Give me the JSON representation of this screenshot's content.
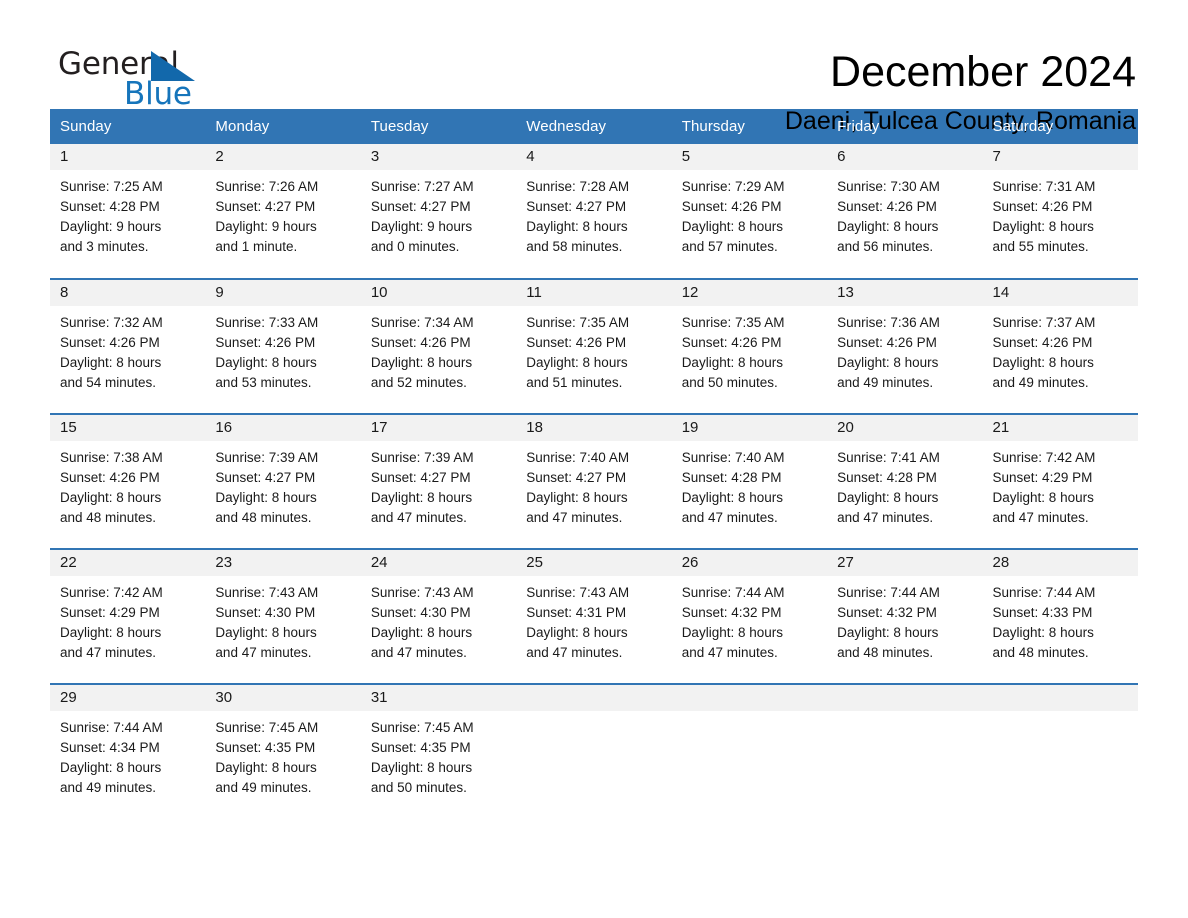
{
  "brand": {
    "name_part1": "General",
    "name_part2": "Blue",
    "accent_color": "#1268ab"
  },
  "header": {
    "month_title": "December 2024",
    "location": "Daeni, Tulcea County, Romania"
  },
  "calendar": {
    "header_background": "#3175b4",
    "daynum_background": "#f2f2f2",
    "weekday_headers": [
      "Sunday",
      "Monday",
      "Tuesday",
      "Wednesday",
      "Thursday",
      "Friday",
      "Saturday"
    ],
    "weeks": [
      [
        {
          "day": "1",
          "sunrise": "Sunrise: 7:25 AM",
          "sunset": "Sunset: 4:28 PM",
          "daylight_line1": "Daylight: 9 hours",
          "daylight_line2": "and 3 minutes."
        },
        {
          "day": "2",
          "sunrise": "Sunrise: 7:26 AM",
          "sunset": "Sunset: 4:27 PM",
          "daylight_line1": "Daylight: 9 hours",
          "daylight_line2": "and 1 minute."
        },
        {
          "day": "3",
          "sunrise": "Sunrise: 7:27 AM",
          "sunset": "Sunset: 4:27 PM",
          "daylight_line1": "Daylight: 9 hours",
          "daylight_line2": "and 0 minutes."
        },
        {
          "day": "4",
          "sunrise": "Sunrise: 7:28 AM",
          "sunset": "Sunset: 4:27 PM",
          "daylight_line1": "Daylight: 8 hours",
          "daylight_line2": "and 58 minutes."
        },
        {
          "day": "5",
          "sunrise": "Sunrise: 7:29 AM",
          "sunset": "Sunset: 4:26 PM",
          "daylight_line1": "Daylight: 8 hours",
          "daylight_line2": "and 57 minutes."
        },
        {
          "day": "6",
          "sunrise": "Sunrise: 7:30 AM",
          "sunset": "Sunset: 4:26 PM",
          "daylight_line1": "Daylight: 8 hours",
          "daylight_line2": "and 56 minutes."
        },
        {
          "day": "7",
          "sunrise": "Sunrise: 7:31 AM",
          "sunset": "Sunset: 4:26 PM",
          "daylight_line1": "Daylight: 8 hours",
          "daylight_line2": "and 55 minutes."
        }
      ],
      [
        {
          "day": "8",
          "sunrise": "Sunrise: 7:32 AM",
          "sunset": "Sunset: 4:26 PM",
          "daylight_line1": "Daylight: 8 hours",
          "daylight_line2": "and 54 minutes."
        },
        {
          "day": "9",
          "sunrise": "Sunrise: 7:33 AM",
          "sunset": "Sunset: 4:26 PM",
          "daylight_line1": "Daylight: 8 hours",
          "daylight_line2": "and 53 minutes."
        },
        {
          "day": "10",
          "sunrise": "Sunrise: 7:34 AM",
          "sunset": "Sunset: 4:26 PM",
          "daylight_line1": "Daylight: 8 hours",
          "daylight_line2": "and 52 minutes."
        },
        {
          "day": "11",
          "sunrise": "Sunrise: 7:35 AM",
          "sunset": "Sunset: 4:26 PM",
          "daylight_line1": "Daylight: 8 hours",
          "daylight_line2": "and 51 minutes."
        },
        {
          "day": "12",
          "sunrise": "Sunrise: 7:35 AM",
          "sunset": "Sunset: 4:26 PM",
          "daylight_line1": "Daylight: 8 hours",
          "daylight_line2": "and 50 minutes."
        },
        {
          "day": "13",
          "sunrise": "Sunrise: 7:36 AM",
          "sunset": "Sunset: 4:26 PM",
          "daylight_line1": "Daylight: 8 hours",
          "daylight_line2": "and 49 minutes."
        },
        {
          "day": "14",
          "sunrise": "Sunrise: 7:37 AM",
          "sunset": "Sunset: 4:26 PM",
          "daylight_line1": "Daylight: 8 hours",
          "daylight_line2": "and 49 minutes."
        }
      ],
      [
        {
          "day": "15",
          "sunrise": "Sunrise: 7:38 AM",
          "sunset": "Sunset: 4:26 PM",
          "daylight_line1": "Daylight: 8 hours",
          "daylight_line2": "and 48 minutes."
        },
        {
          "day": "16",
          "sunrise": "Sunrise: 7:39 AM",
          "sunset": "Sunset: 4:27 PM",
          "daylight_line1": "Daylight: 8 hours",
          "daylight_line2": "and 48 minutes."
        },
        {
          "day": "17",
          "sunrise": "Sunrise: 7:39 AM",
          "sunset": "Sunset: 4:27 PM",
          "daylight_line1": "Daylight: 8 hours",
          "daylight_line2": "and 47 minutes."
        },
        {
          "day": "18",
          "sunrise": "Sunrise: 7:40 AM",
          "sunset": "Sunset: 4:27 PM",
          "daylight_line1": "Daylight: 8 hours",
          "daylight_line2": "and 47 minutes."
        },
        {
          "day": "19",
          "sunrise": "Sunrise: 7:40 AM",
          "sunset": "Sunset: 4:28 PM",
          "daylight_line1": "Daylight: 8 hours",
          "daylight_line2": "and 47 minutes."
        },
        {
          "day": "20",
          "sunrise": "Sunrise: 7:41 AM",
          "sunset": "Sunset: 4:28 PM",
          "daylight_line1": "Daylight: 8 hours",
          "daylight_line2": "and 47 minutes."
        },
        {
          "day": "21",
          "sunrise": "Sunrise: 7:42 AM",
          "sunset": "Sunset: 4:29 PM",
          "daylight_line1": "Daylight: 8 hours",
          "daylight_line2": "and 47 minutes."
        }
      ],
      [
        {
          "day": "22",
          "sunrise": "Sunrise: 7:42 AM",
          "sunset": "Sunset: 4:29 PM",
          "daylight_line1": "Daylight: 8 hours",
          "daylight_line2": "and 47 minutes."
        },
        {
          "day": "23",
          "sunrise": "Sunrise: 7:43 AM",
          "sunset": "Sunset: 4:30 PM",
          "daylight_line1": "Daylight: 8 hours",
          "daylight_line2": "and 47 minutes."
        },
        {
          "day": "24",
          "sunrise": "Sunrise: 7:43 AM",
          "sunset": "Sunset: 4:30 PM",
          "daylight_line1": "Daylight: 8 hours",
          "daylight_line2": "and 47 minutes."
        },
        {
          "day": "25",
          "sunrise": "Sunrise: 7:43 AM",
          "sunset": "Sunset: 4:31 PM",
          "daylight_line1": "Daylight: 8 hours",
          "daylight_line2": "and 47 minutes."
        },
        {
          "day": "26",
          "sunrise": "Sunrise: 7:44 AM",
          "sunset": "Sunset: 4:32 PM",
          "daylight_line1": "Daylight: 8 hours",
          "daylight_line2": "and 47 minutes."
        },
        {
          "day": "27",
          "sunrise": "Sunrise: 7:44 AM",
          "sunset": "Sunset: 4:32 PM",
          "daylight_line1": "Daylight: 8 hours",
          "daylight_line2": "and 48 minutes."
        },
        {
          "day": "28",
          "sunrise": "Sunrise: 7:44 AM",
          "sunset": "Sunset: 4:33 PM",
          "daylight_line1": "Daylight: 8 hours",
          "daylight_line2": "and 48 minutes."
        }
      ],
      [
        {
          "day": "29",
          "sunrise": "Sunrise: 7:44 AM",
          "sunset": "Sunset: 4:34 PM",
          "daylight_line1": "Daylight: 8 hours",
          "daylight_line2": "and 49 minutes."
        },
        {
          "day": "30",
          "sunrise": "Sunrise: 7:45 AM",
          "sunset": "Sunset: 4:35 PM",
          "daylight_line1": "Daylight: 8 hours",
          "daylight_line2": "and 49 minutes."
        },
        {
          "day": "31",
          "sunrise": "Sunrise: 7:45 AM",
          "sunset": "Sunset: 4:35 PM",
          "daylight_line1": "Daylight: 8 hours",
          "daylight_line2": "and 50 minutes."
        },
        {
          "day": "",
          "sunrise": "",
          "sunset": "",
          "daylight_line1": "",
          "daylight_line2": ""
        },
        {
          "day": "",
          "sunrise": "",
          "sunset": "",
          "daylight_line1": "",
          "daylight_line2": ""
        },
        {
          "day": "",
          "sunrise": "",
          "sunset": "",
          "daylight_line1": "",
          "daylight_line2": ""
        },
        {
          "day": "",
          "sunrise": "",
          "sunset": "",
          "daylight_line1": "",
          "daylight_line2": ""
        }
      ]
    ]
  }
}
